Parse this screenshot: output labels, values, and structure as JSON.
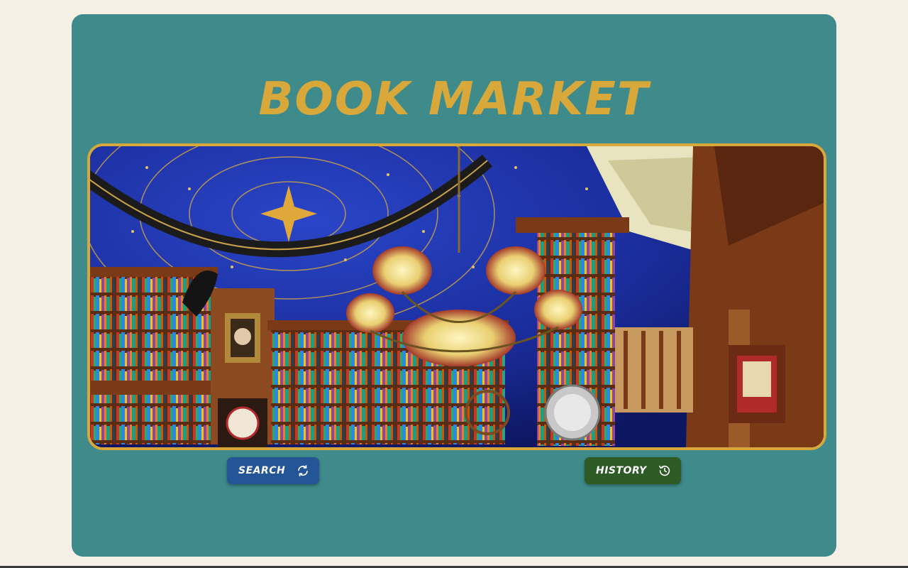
{
  "app": {
    "title": "BOOK MARKET"
  },
  "hero": {
    "image": "illustrated-library-interior",
    "border_color": "#d8a83a"
  },
  "actions": {
    "search_label": "SEARCH",
    "search_icon": "refresh-icon",
    "history_label": "HISTORY",
    "history_icon": "history-icon"
  },
  "colors": {
    "page_background": "#f6efe6",
    "card_background": "#3f8b8b",
    "title": "#d8a83a",
    "search_button": "#235597",
    "history_button": "#2e5a25"
  }
}
